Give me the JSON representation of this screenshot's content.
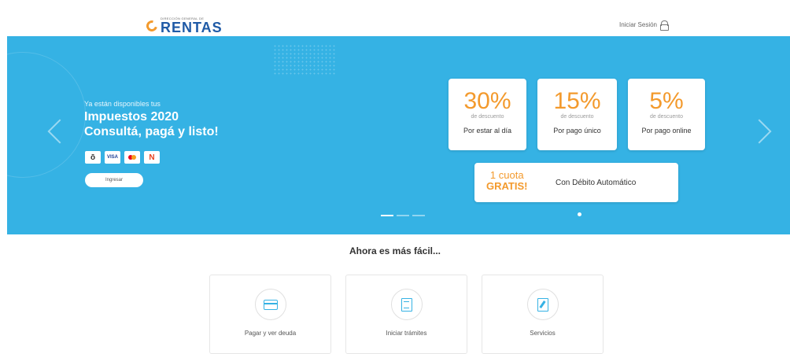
{
  "header": {
    "logo_subtitle": "DIRECCIÓN GENERAL DE",
    "logo_title": "RENTAS",
    "login_label": "Iniciar Sesión"
  },
  "hero": {
    "intro": "Ya están disponibles tus",
    "title_line1": "Impuestos 2020",
    "title_line2": "Consultá, pagá y listo!",
    "payment_icons": [
      "rapipago-icon",
      "visa-icon",
      "mastercard-icon",
      "naranja-icon"
    ],
    "payment_visa_text": "VISA",
    "ingresar_label": "Ingresar",
    "discounts": [
      {
        "pct": "30%",
        "desc": "de descuento",
        "foot": "Por estar al día"
      },
      {
        "pct": "15%",
        "desc": "de descuento",
        "foot": "Por pago único"
      },
      {
        "pct": "5%",
        "desc": "de descuento",
        "foot": "Por pago online"
      }
    ],
    "cuota": {
      "line1": "1 cuota",
      "line2": "GRATIS!",
      "text": "Con Débito Automático"
    },
    "accent_color": "#f39a2d",
    "background_color": "#35b2e4"
  },
  "main": {
    "section_title": "Ahora es más fácil...",
    "actions": [
      {
        "label": "Pagar y ver deuda",
        "icon": "credit-card-icon"
      },
      {
        "label": "Iniciar trámites",
        "icon": "document-icon"
      },
      {
        "label": "Servicios",
        "icon": "edit-document-icon"
      }
    ]
  }
}
